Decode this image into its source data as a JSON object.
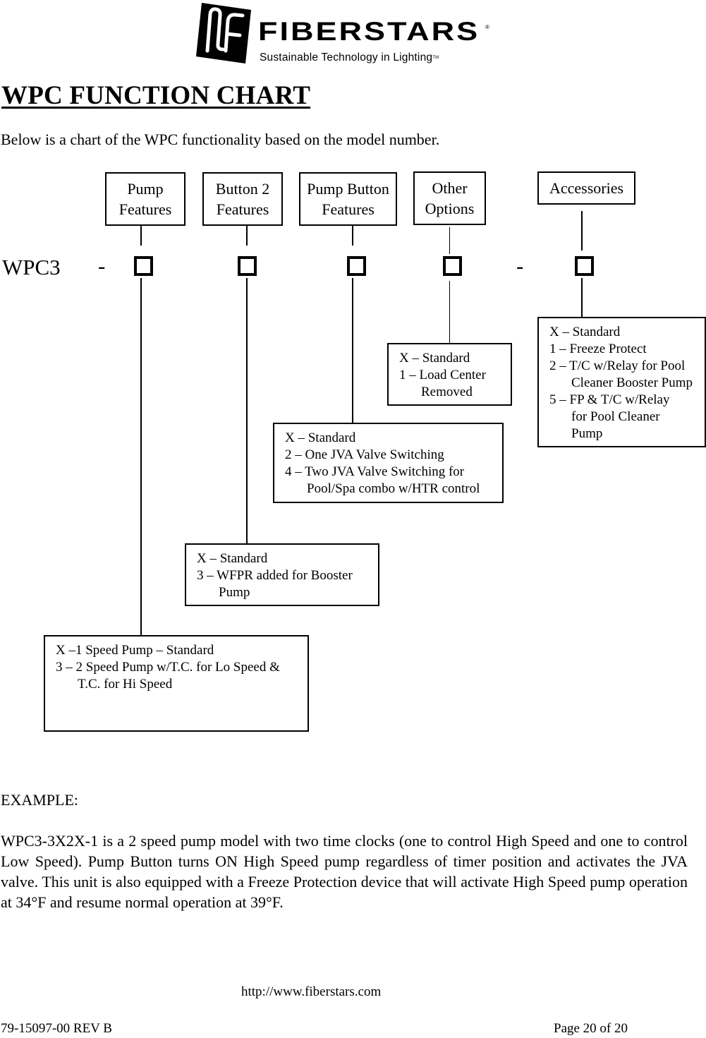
{
  "logo": {
    "brand": "FIBERSTARS",
    "registered": "®",
    "tagline": "Sustainable Technology in Lighting",
    "trademark": "TM"
  },
  "title": "WPC FUNCTION CHART",
  "intro": "Below is a chart of the WPC functionality based on the model number.",
  "model": {
    "prefix": "WPC3",
    "separator1": "-",
    "separator2": "-",
    "slots": [
      "Pump Features",
      "Button 2 Features",
      "Pump Button Features",
      "Other Options",
      "Accessories"
    ]
  },
  "headers": {
    "pump": [
      "Pump",
      "Features"
    ],
    "button2": [
      "Button 2",
      "Features"
    ],
    "pump_button": [
      "Pump Button",
      "Features"
    ],
    "other": [
      "Other",
      "Options"
    ],
    "accessories": [
      "Accessories"
    ]
  },
  "options": {
    "pump": [
      {
        "text": "X –1 Speed Pump – Standard",
        "indent": false
      },
      {
        "text": "3 – 2 Speed Pump w/T.C. for Lo Speed &",
        "indent": false
      },
      {
        "text": "T.C. for Hi Speed",
        "indent": true
      }
    ],
    "button2": [
      {
        "text": "X – Standard",
        "indent": false
      },
      {
        "text": "3 – WFPR added for Booster",
        "indent": false
      },
      {
        "text": "Pump",
        "indent": true
      }
    ],
    "pump_button": [
      {
        "text": "X – Standard",
        "indent": false
      },
      {
        "text": "2 – One JVA Valve Switching",
        "indent": false
      },
      {
        "text": "4 – Two JVA Valve Switching for",
        "indent": false
      },
      {
        "text": "Pool/Spa combo w/HTR control",
        "indent": true
      }
    ],
    "other": [
      {
        "text": "X – Standard",
        "indent": false
      },
      {
        "text": "1 – Load Center",
        "indent": false
      },
      {
        "text": "Removed",
        "indent": true
      }
    ],
    "accessories": [
      {
        "text": "X – Standard",
        "indent": false
      },
      {
        "text": "1 – Freeze Protect",
        "indent": false
      },
      {
        "text": "2 – T/C w/Relay for Pool",
        "indent": false
      },
      {
        "text": "Cleaner Booster Pump",
        "indent": true
      },
      {
        "text": "5 – FP & T/C w/Relay",
        "indent": false
      },
      {
        "text": "for Pool Cleaner",
        "indent": true
      },
      {
        "text": "Pump",
        "indent": true
      }
    ]
  },
  "example": {
    "heading": "EXAMPLE:",
    "body": "WPC3-3X2X-1 is a 2 speed pump model with two time clocks (one to control High Speed and one to control Low Speed).  Pump Button turns ON High Speed pump regardless of timer position and activates the JVA valve.  This unit is also equipped with a Freeze Protection device that will activate High Speed pump operation at 34°F and resume normal operation at 39°F."
  },
  "footer": {
    "url": "http://www.fiberstars.com",
    "doc_number": "79-15097-00 REV B",
    "page": "Page 20 of 20"
  }
}
